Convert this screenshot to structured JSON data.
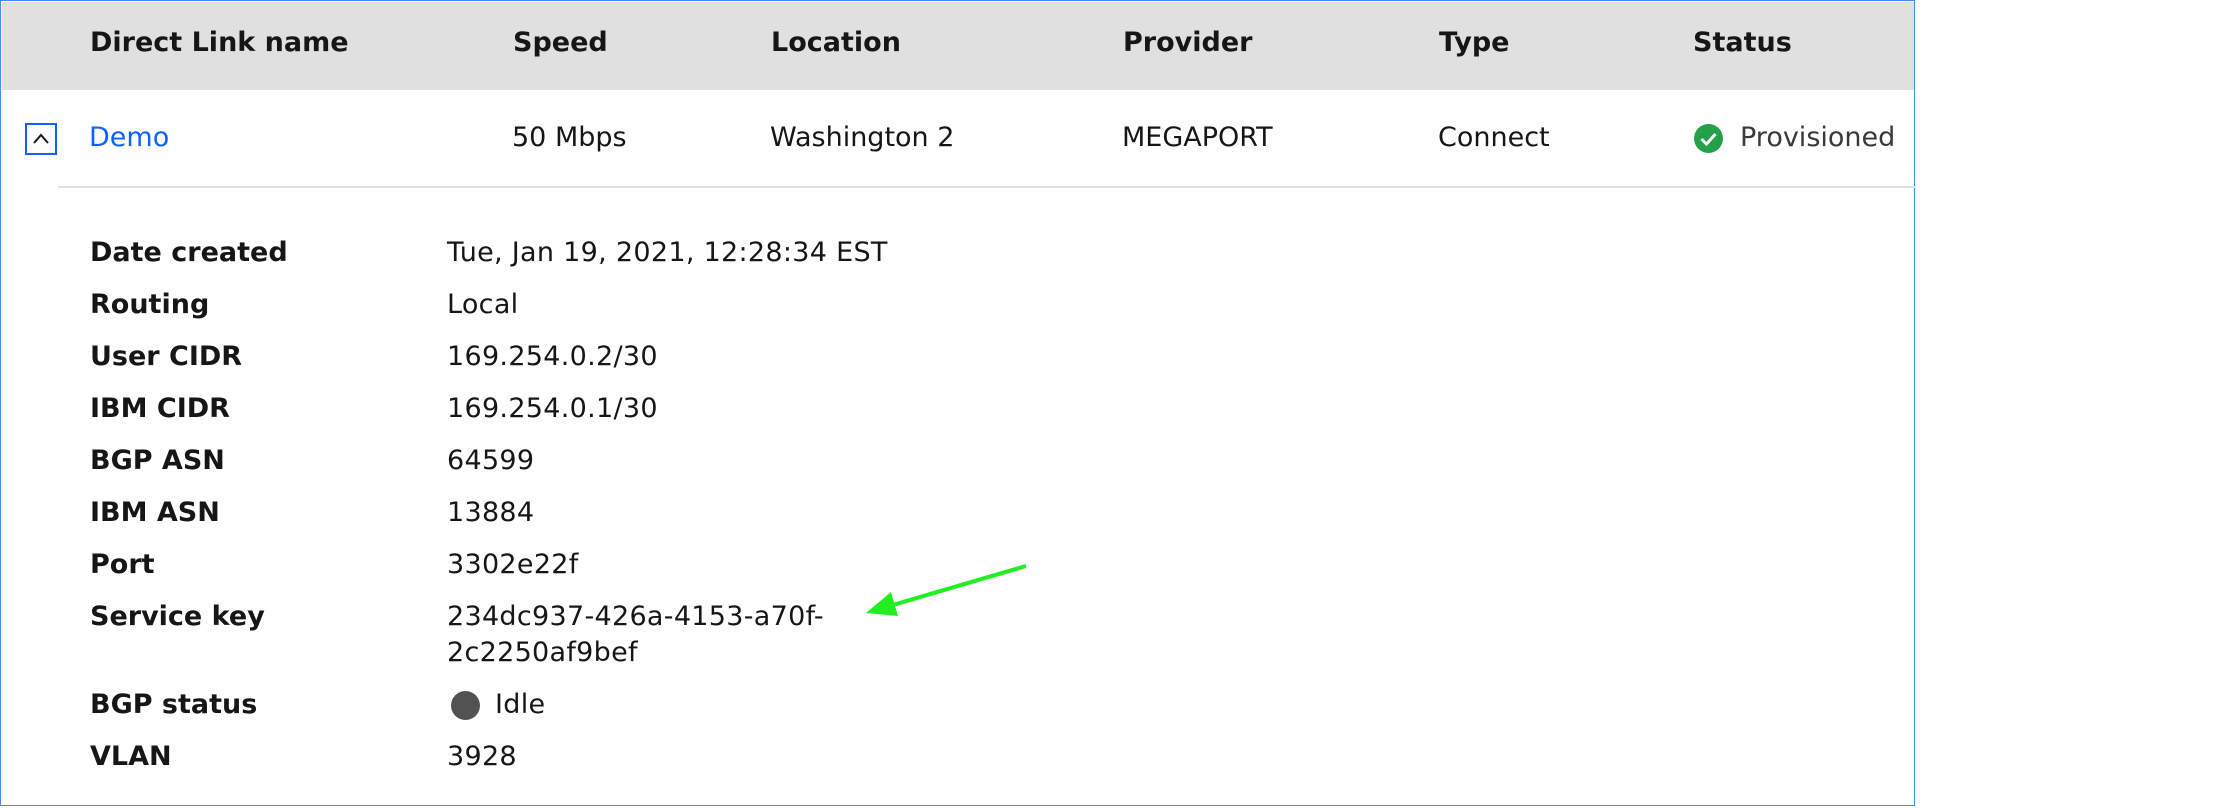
{
  "table": {
    "headers": {
      "name": "Direct Link name",
      "speed": "Speed",
      "location": "Location",
      "provider": "Provider",
      "type": "Type",
      "status": "Status"
    },
    "rows": [
      {
        "name": "Demo",
        "speed": "50 Mbps",
        "location": "Washington 2",
        "provider": "MEGAPORT",
        "type": "Connect",
        "status": "Provisioned",
        "status_icon": "checkmark-filled-icon",
        "status_color": "#24a148",
        "expanded": true
      }
    ]
  },
  "details": {
    "date_created": {
      "label": "Date created",
      "value": "Tue, Jan 19, 2021, 12:28:34 EST"
    },
    "routing": {
      "label": "Routing",
      "value": "Local"
    },
    "user_cidr": {
      "label": "User CIDR",
      "value": "169.254.0.2/30"
    },
    "ibm_cidr": {
      "label": "IBM CIDR",
      "value": "169.254.0.1/30"
    },
    "bgp_asn": {
      "label": "BGP ASN",
      "value": "64599"
    },
    "ibm_asn": {
      "label": "IBM ASN",
      "value": "13884"
    },
    "port": {
      "label": "Port",
      "value": "3302e22f"
    },
    "service_key": {
      "label": "Service key",
      "value_line1": "234dc937-426a-4153-a70f-",
      "value_line2": "2c2250af9bef"
    },
    "bgp_status": {
      "label": "BGP status",
      "value": "Idle",
      "indicator_color": "#525252"
    },
    "vlan": {
      "label": "VLAN",
      "value": "3928"
    }
  },
  "colors": {
    "link": "#0f62fe",
    "header_bg": "#e0e0e0",
    "annotation_arrow": "#22ee22"
  }
}
